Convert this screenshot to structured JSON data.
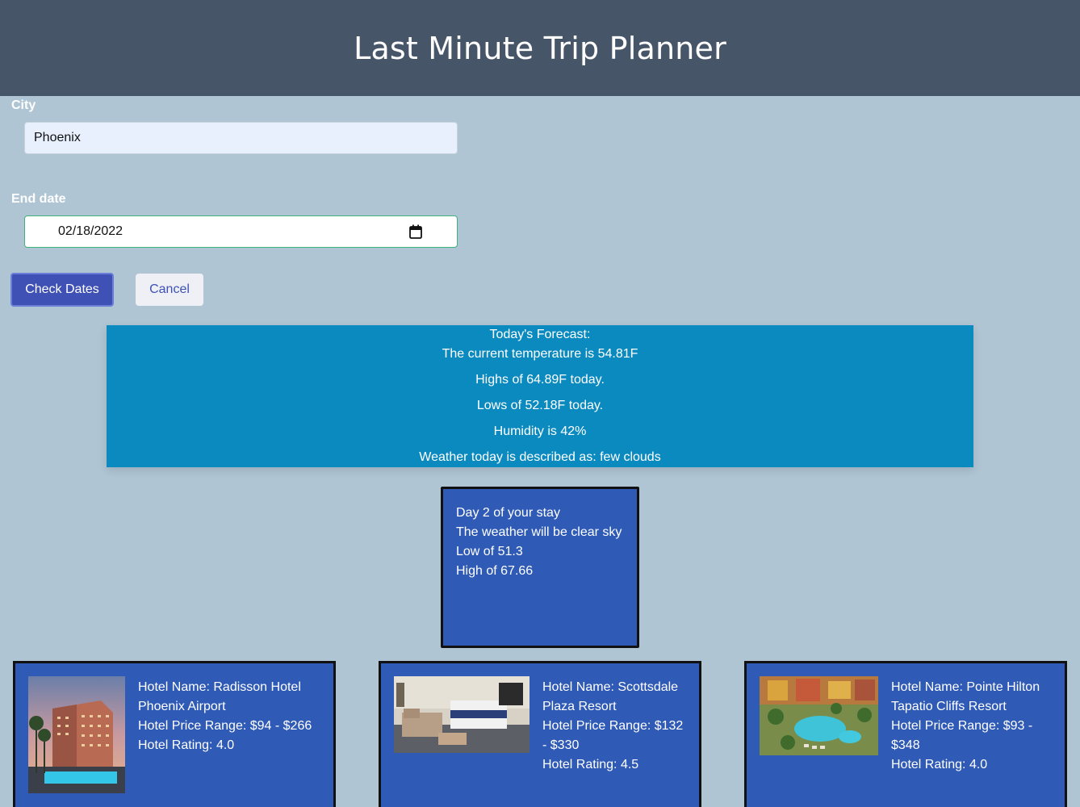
{
  "header": {
    "title": "Last Minute Trip Planner"
  },
  "form": {
    "city_label": "City",
    "city_value": "Phoenix",
    "end_date_label": "End date",
    "end_date_value": "02/18/2022",
    "check_button": "Check Dates",
    "cancel_button": "Cancel"
  },
  "forecast": {
    "heading": "Today's Forecast:",
    "current": "The current temperature is 54.81F",
    "highs": "Highs of 64.89F today.",
    "lows": "Lows of 52.18F today.",
    "humidity": "Humidity is 42%",
    "description": "Weather today is described as: few clouds"
  },
  "day_card": {
    "day": "Day 2 of your stay",
    "weather": "The weather will be clear sky",
    "low": "Low of 51.3",
    "high": "High of 67.66"
  },
  "hotels": [
    {
      "name_line1": "Hotel Name: Radisson Hotel",
      "name_line2": "Phoenix Airport",
      "price_line1": "Hotel Price Range: $94 - $266",
      "price_line2": "",
      "rating": "Hotel Rating: 4.0"
    },
    {
      "name_line1": "Hotel Name: Scottsdale",
      "name_line2": "Plaza Resort",
      "price_line1": "Hotel Price Range: $132",
      "price_line2": "- $330",
      "rating": "Hotel Rating: 4.5"
    },
    {
      "name_line1": "Hotel Name: Pointe Hilton",
      "name_line2": "Tapatio Cliffs Resort",
      "price_line1": "Hotel Price Range: $93 -",
      "price_line2": "$348",
      "rating": "Hotel Rating: 4.0"
    }
  ]
}
